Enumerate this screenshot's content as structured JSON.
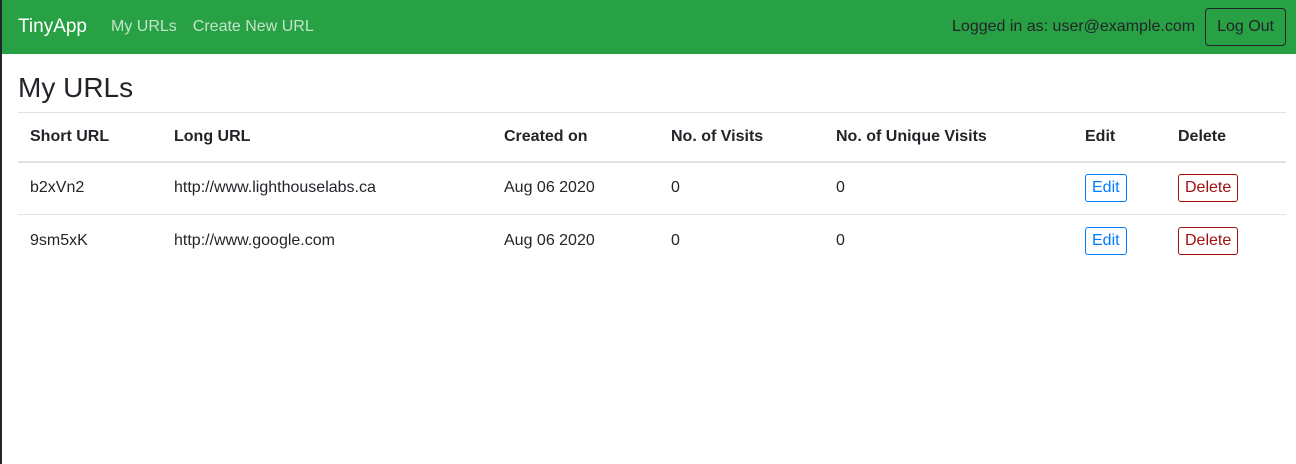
{
  "navbar": {
    "brand": "TinyApp",
    "links": [
      "My URLs",
      "Create New URL"
    ],
    "login_text": "Logged in as: user@example.com",
    "logout_label": "Log Out",
    "bg_color": "#28a044"
  },
  "page": {
    "title": "My URLs"
  },
  "table": {
    "headers": [
      "Short URL",
      "Long URL",
      "Created on",
      "No. of Visits",
      "No. of Unique Visits",
      "Edit",
      "Delete"
    ],
    "rows": [
      {
        "short_url": "b2xVn2",
        "long_url": "http://www.lighthouselabs.ca",
        "created_on": "Aug 06 2020",
        "visits": "0",
        "unique_visits": "0",
        "edit_label": "Edit",
        "delete_label": "Delete"
      },
      {
        "short_url": "9sm5xK",
        "long_url": "http://www.google.com",
        "created_on": "Aug 06 2020",
        "visits": "0",
        "unique_visits": "0",
        "edit_label": "Edit",
        "delete_label": "Delete"
      }
    ]
  },
  "colors": {
    "edit": "#007bff",
    "delete": "#a01010"
  }
}
